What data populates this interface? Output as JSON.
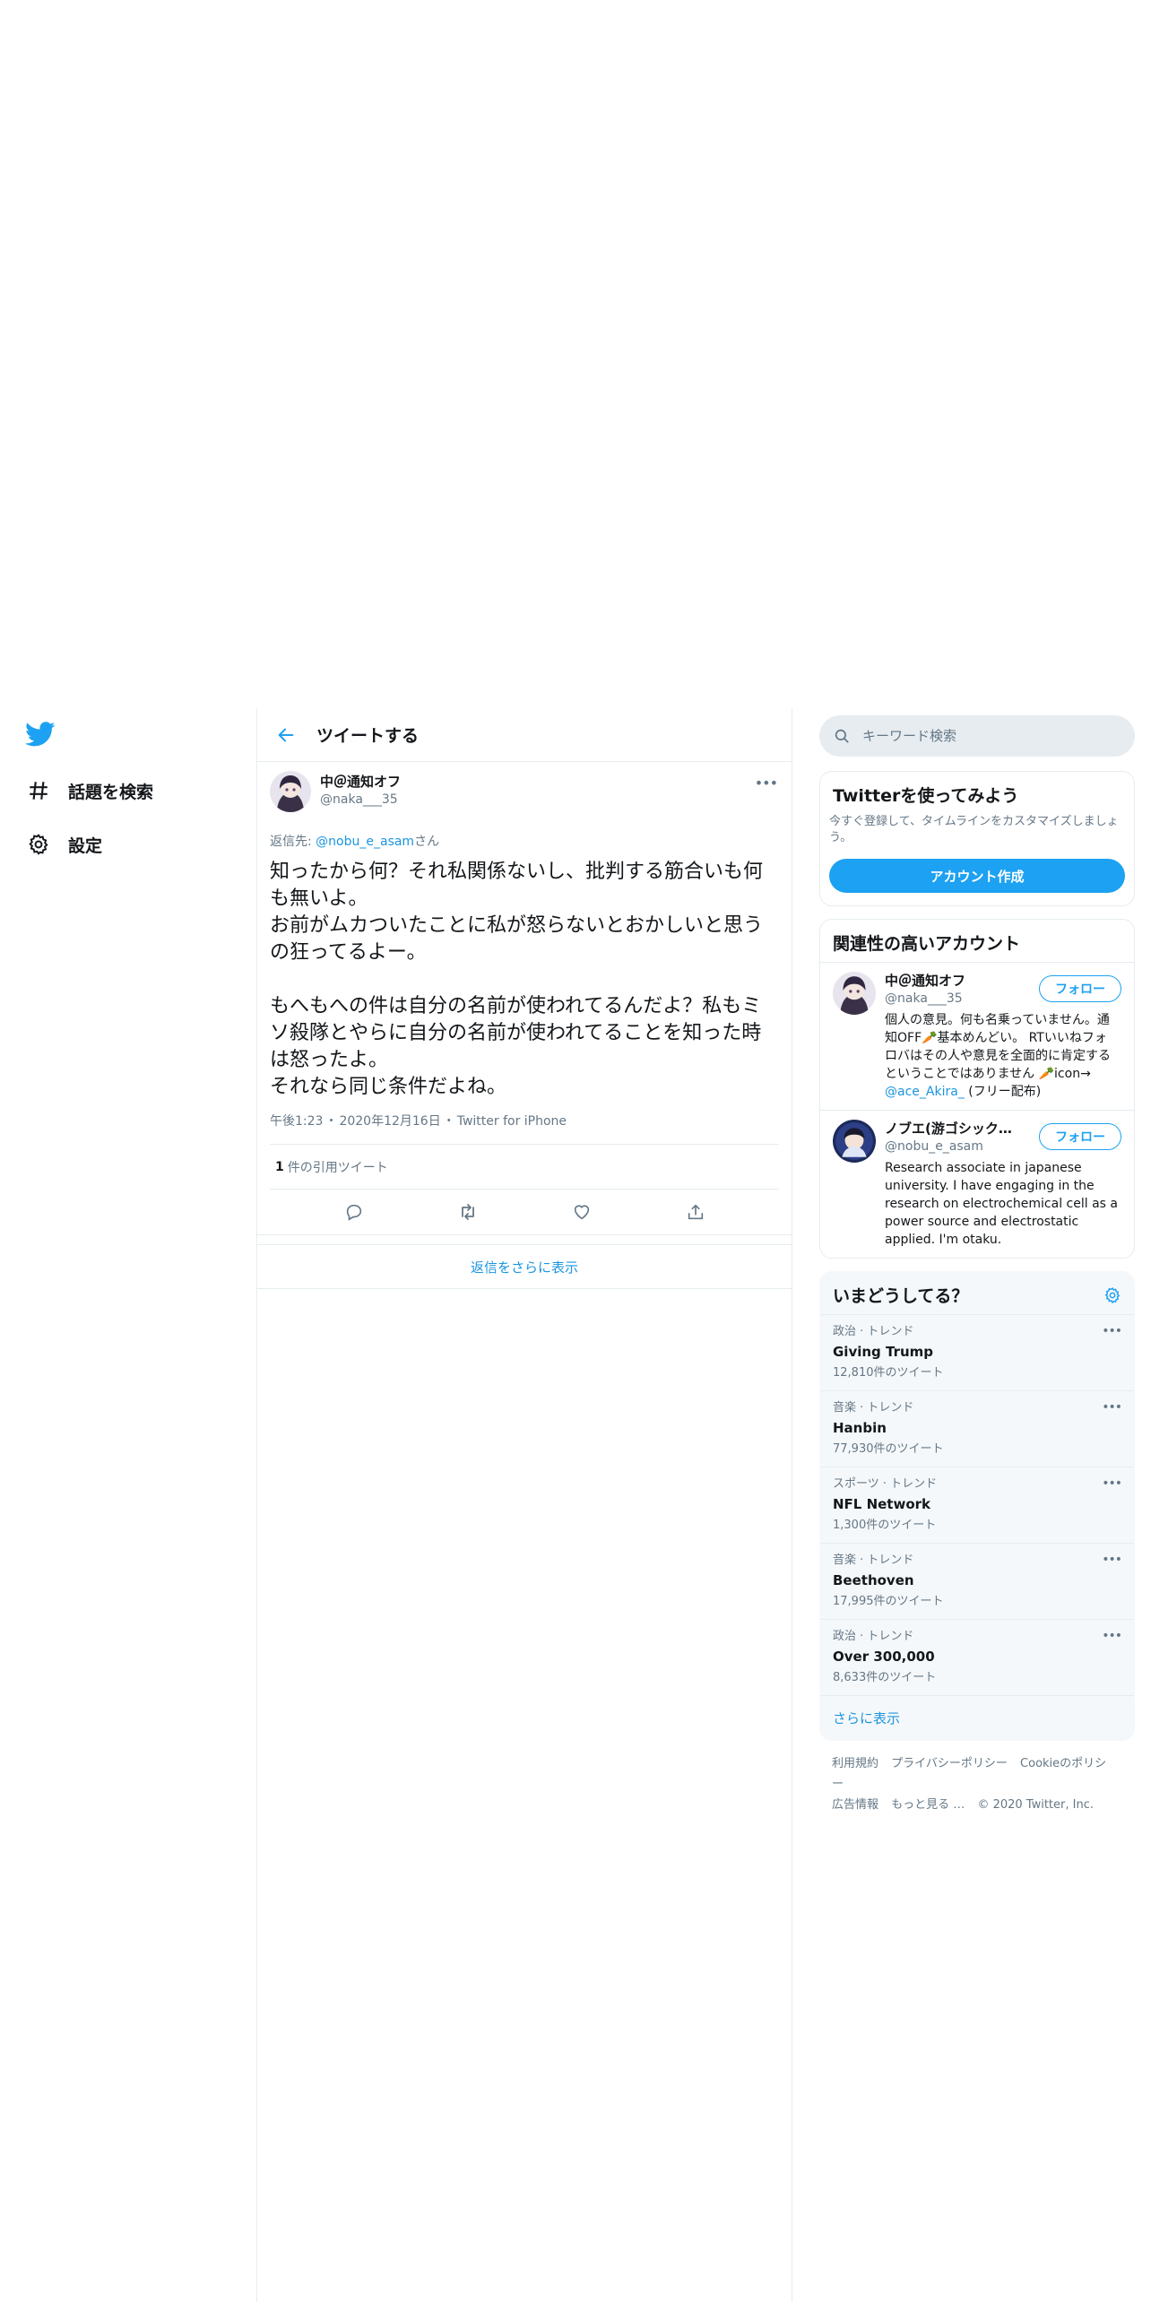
{
  "nav": {
    "items": [
      {
        "label": "話題を検索",
        "icon": "hashtag-icon"
      },
      {
        "label": "設定",
        "icon": "gear-icon"
      }
    ]
  },
  "header": {
    "title": "ツイートする"
  },
  "tweet": {
    "display_name": "中＠通知オフ",
    "handle": "@naka___35",
    "reply_prefix": "返信先: ",
    "reply_to": "@nobu_e_asam",
    "reply_suffix": "さん",
    "text": "知ったから何？それ私関係ないし、批判する筋合いも何も無いよ。\nお前がムカついたことに私が怒らないとおかしいと思うの狂ってるよー。\n\nもへもへの件は自分の名前が使われてるんだよ？私もミソ殺隊とやらに自分の名前が使われてることを知った時は怒ったよ。\nそれなら同じ条件だよね。",
    "time": "午後1:23",
    "date": "2020年12月16日",
    "source": "Twitter for iPhone",
    "sep": "・",
    "quote_count": "1",
    "quote_label": "件の引用ツイート"
  },
  "show_more_replies": "返信をさらに表示",
  "search": {
    "placeholder": "キーワード検索"
  },
  "signup": {
    "title": "Twitterを使ってみよう",
    "desc": "今すぐ登録して、タイムラインをカスタマイズしましょう。",
    "button": "アカウント作成"
  },
  "related": {
    "title": "関連性の高いアカウント",
    "follow_label": "フォロー",
    "accounts": [
      {
        "name": "中＠通知オフ",
        "handle": "@naka___35",
        "bio_pre": "個人の意見。何も名乗っていません。通知OFF🥕基本めんどい。 RTいいねフォロバはその人や意見を全面的に肯定するということではありません 🥕icon→ ",
        "bio_link": "@ace_Akira_",
        "bio_post": " (フリー配布)"
      },
      {
        "name": "ノブエ(游ゴシック撲滅委員会)",
        "handle": "@nobu_e_asam",
        "bio_pre": "Research associate in japanese university. I have engaging in the research on electrochemical cell as a power source and electrostatic applied. I'm otaku.",
        "bio_link": "",
        "bio_post": ""
      }
    ]
  },
  "trends": {
    "title": "いまどうしてる？",
    "items": [
      {
        "category": "政治 · トレンド",
        "name": "Giving Trump",
        "count": "12,810件のツイート"
      },
      {
        "category": "音楽 · トレンド",
        "name": "Hanbin",
        "count": "77,930件のツイート"
      },
      {
        "category": "スポーツ · トレンド",
        "name": "NFL Network",
        "count": "1,300件のツイート"
      },
      {
        "category": "音楽 · トレンド",
        "name": "Beethoven",
        "count": "17,995件のツイート"
      },
      {
        "category": "政治 · トレンド",
        "name": "Over 300,000",
        "count": "8,633件のツイート"
      }
    ],
    "show_more": "さらに表示"
  },
  "footer": {
    "links": [
      "利用規約",
      "プライバシーポリシー",
      "Cookieのポリシー",
      "広告情報",
      "もっと見る …"
    ],
    "copyright": "© 2020 Twitter, Inc."
  },
  "colors": {
    "accent": "#1da1f2",
    "link": "#1b95e0",
    "muted": "#657786",
    "border": "#e6ecf0"
  }
}
